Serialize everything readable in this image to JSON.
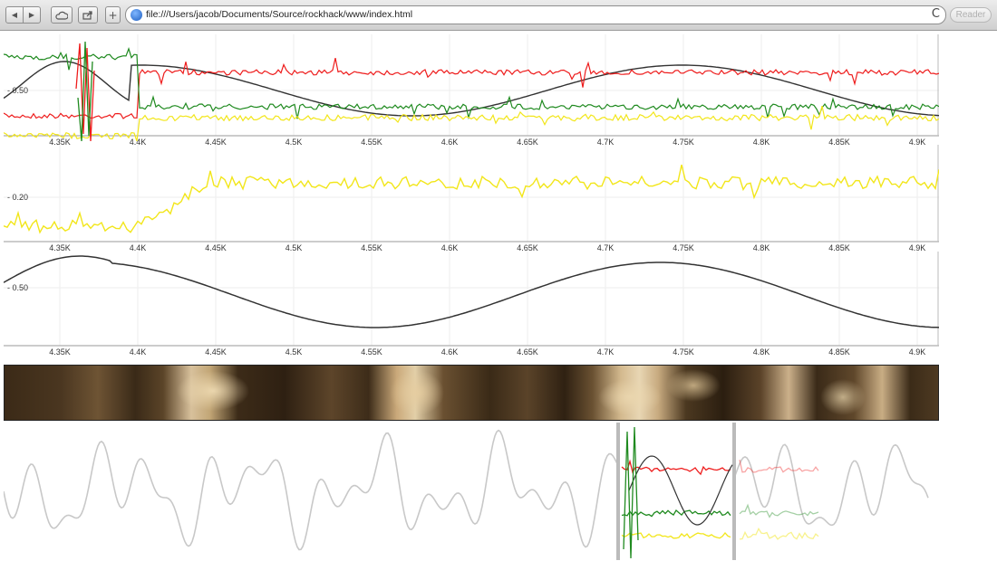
{
  "browser": {
    "url": "file:///Users/jacob/Documents/Source/rockhack/www/index.html",
    "reader_label": "Reader",
    "reload_symbol": "C",
    "back_symbol": "◀",
    "forward_symbol": "▶",
    "add_symbol": "+"
  },
  "colors": {
    "red": "#ee1c1c",
    "green": "#1f8a1f",
    "yellow": "#f2e61a",
    "black": "#333333",
    "overview_gray": "#c8c8c8"
  },
  "axis": {
    "x_ticks": [
      "4.35K",
      "4.4K",
      "4.45K",
      "4.5K",
      "4.55K",
      "4.6K",
      "4.65K",
      "4.7K",
      "4.75K",
      "4.8K",
      "4.85K",
      "4.9K"
    ]
  },
  "panels": [
    {
      "name": "multi-series-chart",
      "y_tick_label": "0.50",
      "series": [
        "red",
        "green",
        "yellow",
        "black"
      ]
    },
    {
      "name": "yellow-series-chart",
      "y_tick_label": "0.20",
      "series": [
        "yellow"
      ]
    },
    {
      "name": "black-series-chart",
      "y_tick_label": "0.50",
      "series": [
        "black"
      ]
    }
  ],
  "overview": {
    "description_series": [
      "gray"
    ],
    "selection_series": [
      "red",
      "green",
      "yellow",
      "black"
    ]
  }
}
